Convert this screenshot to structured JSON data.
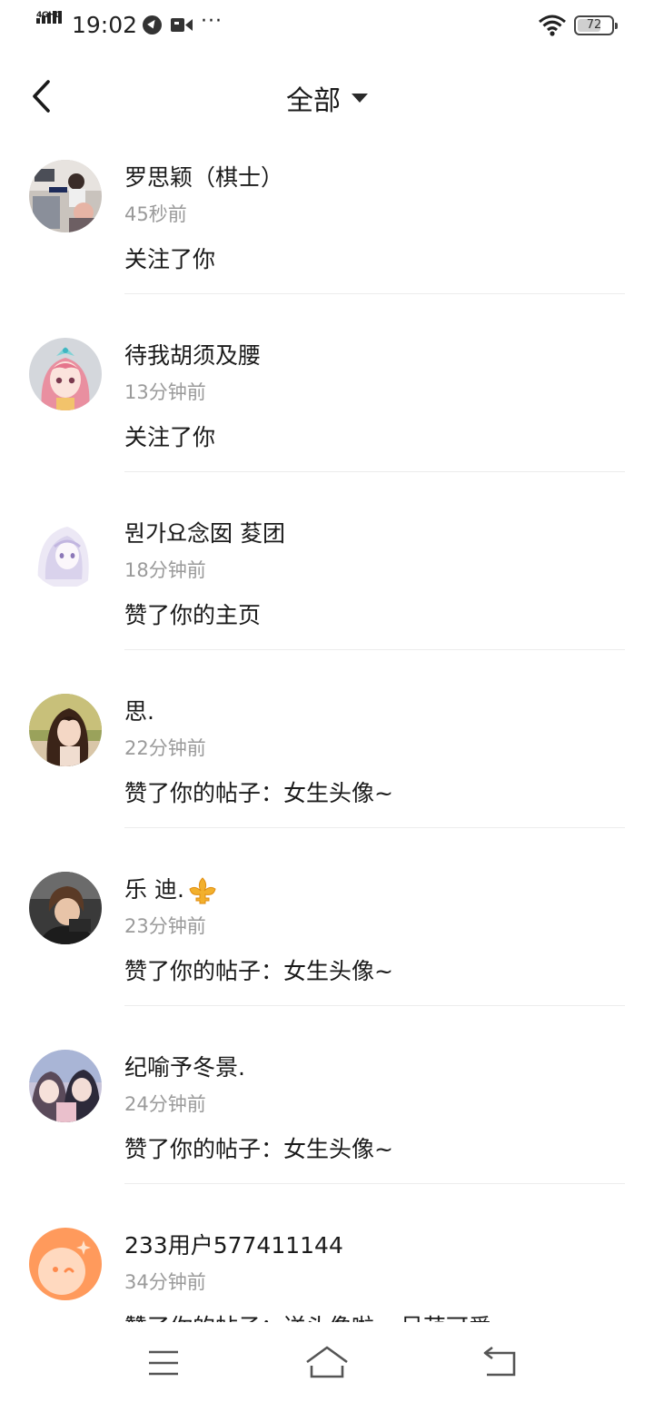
{
  "status_bar": {
    "network": "4GHD",
    "time": "19:02",
    "more": "···",
    "battery": "72",
    "battery_level_percent": 72
  },
  "header": {
    "back_icon": "chevron-left-icon",
    "title": "全部",
    "title_icon": "caret-down-icon"
  },
  "notifications": [
    {
      "name": "罗思颖（棋士）",
      "time": "45秒前",
      "action": "关注了你"
    },
    {
      "name": "待我胡须及腰",
      "time": "13分钟前",
      "action": "关注了你"
    },
    {
      "name": "뭔가요念囡  荾团",
      "time": "18分钟前",
      "action": "赞了你的主页"
    },
    {
      "name": "思.",
      "time": "22分钟前",
      "action": "赞了你的帖子：女生头像~"
    },
    {
      "name": "乐 迪.",
      "name_badge_icon": "fleur-de-lis-icon",
      "time": "23分钟前",
      "action": "赞了你的帖子：女生头像~"
    },
    {
      "name": "纪喻予冬景.",
      "time": "24分钟前",
      "action": "赞了你的帖子：女生头像~"
    },
    {
      "name": "233用户577411144",
      "time": "34分钟前",
      "action": "赞了你的帖子：送头像啦~ 呆萌可爱"
    }
  ],
  "bottom_nav": {
    "menu_icon": "menu-icon",
    "home_icon": "home-icon",
    "back_icon": "return-icon"
  },
  "colors": {
    "text_primary": "#1a1a1a",
    "text_secondary": "#9a9a9a",
    "divider": "#ececec",
    "badge_gold": "#f2b02c",
    "default_avatar": "#ff9a5c"
  }
}
